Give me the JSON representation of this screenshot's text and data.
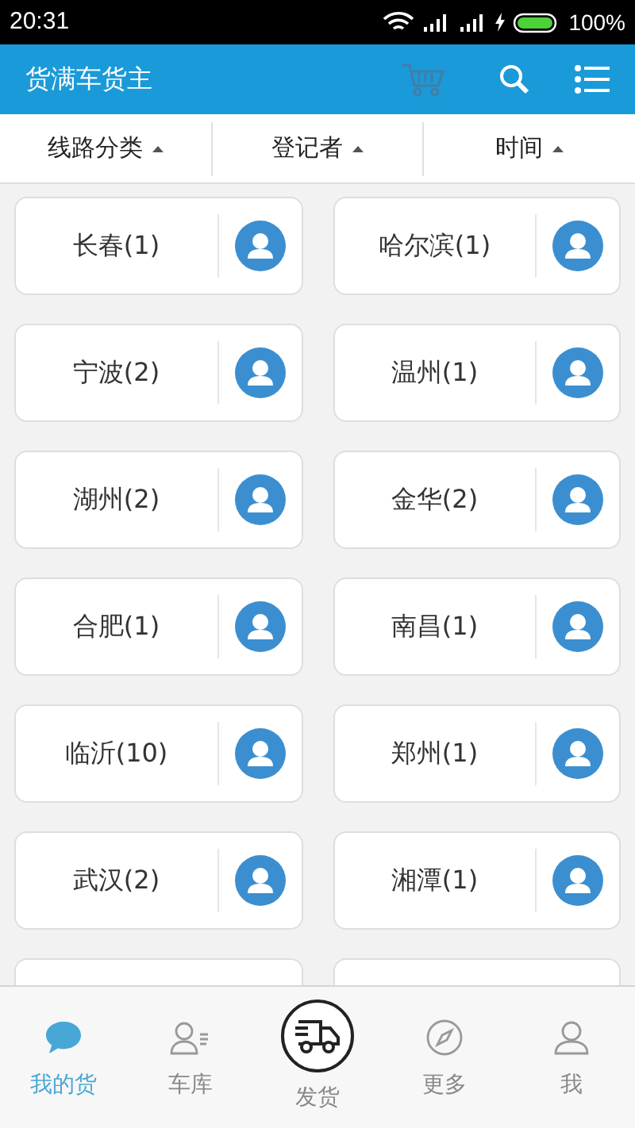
{
  "status_bar": {
    "time": "20:31",
    "battery": "100%"
  },
  "header": {
    "title": "货满车货主"
  },
  "filters": [
    {
      "label": "线路分类"
    },
    {
      "label": "登记者"
    },
    {
      "label": "时间"
    }
  ],
  "cities": [
    {
      "label": "长春(1)"
    },
    {
      "label": "哈尔滨(1)"
    },
    {
      "label": "宁波(2)"
    },
    {
      "label": "温州(1)"
    },
    {
      "label": "湖州(2)"
    },
    {
      "label": "金华(2)"
    },
    {
      "label": "合肥(1)"
    },
    {
      "label": "南昌(1)"
    },
    {
      "label": "临沂(10)"
    },
    {
      "label": "郑州(1)"
    },
    {
      "label": "武汉(2)"
    },
    {
      "label": "湘潭(1)"
    }
  ],
  "tab_bar": [
    {
      "label": "我的货",
      "kind": "chat",
      "selected": true
    },
    {
      "label": "车库",
      "kind": "people",
      "selected": false
    },
    {
      "label": "发货",
      "kind": "truck",
      "selected": false
    },
    {
      "label": "更多",
      "kind": "compass",
      "selected": false
    },
    {
      "label": "我",
      "kind": "person",
      "selected": false
    }
  ]
}
